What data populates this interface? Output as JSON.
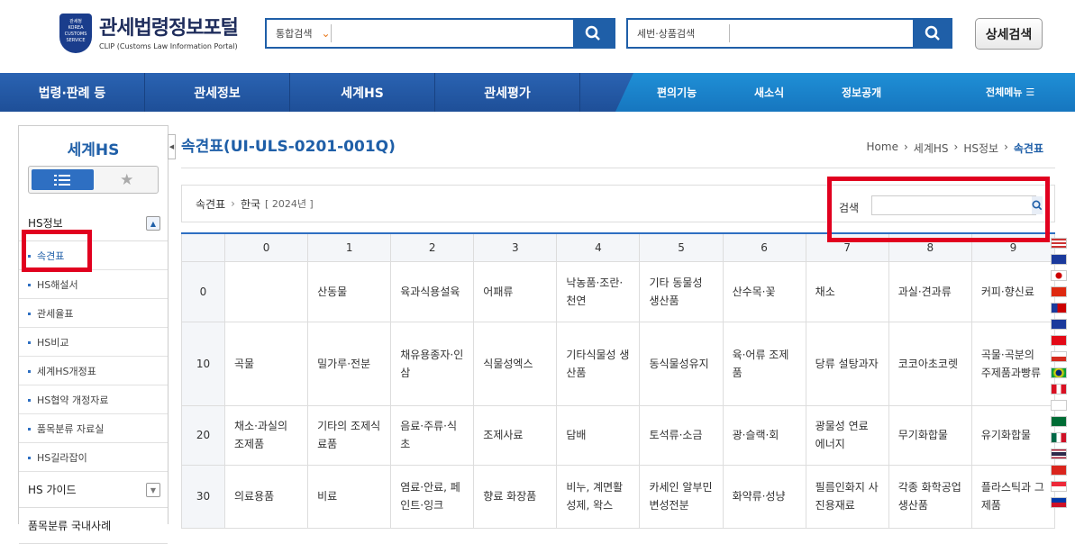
{
  "header": {
    "logo_title": "관세법령정보포털",
    "logo_sub": "CLIP (Customs Law Information Portal)",
    "emblem_text": "관세청 KOREA CUSTOMS SERVICE",
    "search1_select": "통합검색",
    "search1_value": "",
    "search2_label": "세번·상품검색",
    "search2_value": "",
    "detail_search": "상세검색"
  },
  "nav": {
    "items": [
      "법령·판례 등",
      "관세정보",
      "세계HS",
      "관세평가"
    ],
    "sub_items": [
      "편의기능",
      "새소식",
      "정보공개"
    ],
    "all_menu": "전체메뉴"
  },
  "sidebar": {
    "title": "세계HS",
    "section": "HS정보",
    "items": [
      "속견표",
      "HS해설서",
      "관세율표",
      "HS비교",
      "세계HS개정표",
      "HS협약 개정자료",
      "품목분류 자료실",
      "HS길라잡이"
    ],
    "guide": "HS 가이드",
    "next": "품목분류 국내사례"
  },
  "main": {
    "title": "속견표(UI-ULS-0201-001Q)",
    "breadcrumb": [
      "Home",
      "세계HS",
      "HS정보",
      "속견표"
    ],
    "path_a": "속견표",
    "path_b": "한국",
    "year": "[ 2024년 ]",
    "search_label": "검색",
    "search_value": ""
  },
  "table": {
    "headers": [
      "",
      "0",
      "1",
      "2",
      "3",
      "4",
      "5",
      "6",
      "7",
      "8",
      "9"
    ],
    "rows": [
      {
        "h": "0",
        "c": [
          "",
          "산동물",
          "육과식용설육",
          "어패류",
          "낙농품·조란·천연",
          "기타 동물성 생산품",
          "산수목·꽃",
          "채소",
          "과실·견과류",
          "커피·향신료"
        ]
      },
      {
        "h": "10",
        "c": [
          "곡물",
          "밀가루·전분",
          "채유용종자·인삼",
          "식물성엑스",
          "기타식물성 생산품",
          "동식물성유지",
          "육·어류 조제품",
          "당류 설탕과자",
          "코코아초코렛",
          "곡물·곡분의 주제품과빵류"
        ]
      },
      {
        "h": "20",
        "c": [
          "채소·과실의 조제품",
          "기타의 조제식료품",
          "음료·주류·식초",
          "조제사료",
          "담배",
          "토석류·소금",
          "광·슬랙·회",
          "광물성 연료 에너지",
          "무기화합물",
          "유기화합물"
        ]
      },
      {
        "h": "30",
        "c": [
          "의료용품",
          "비료",
          "염료·안료, 페인트·잉크",
          "향료 화장품",
          "비누, 계면활성제, 왁스",
          "카세인 알부민 변성전분",
          "화약류·성냥",
          "필름인화지 사진용재료",
          "각종 화학공업 생산품",
          "플라스틱과 그제품"
        ]
      }
    ]
  },
  "colors": {
    "brand": "#1f5fa8",
    "nav": "#2a63b2",
    "highlight": "#e1001f"
  }
}
